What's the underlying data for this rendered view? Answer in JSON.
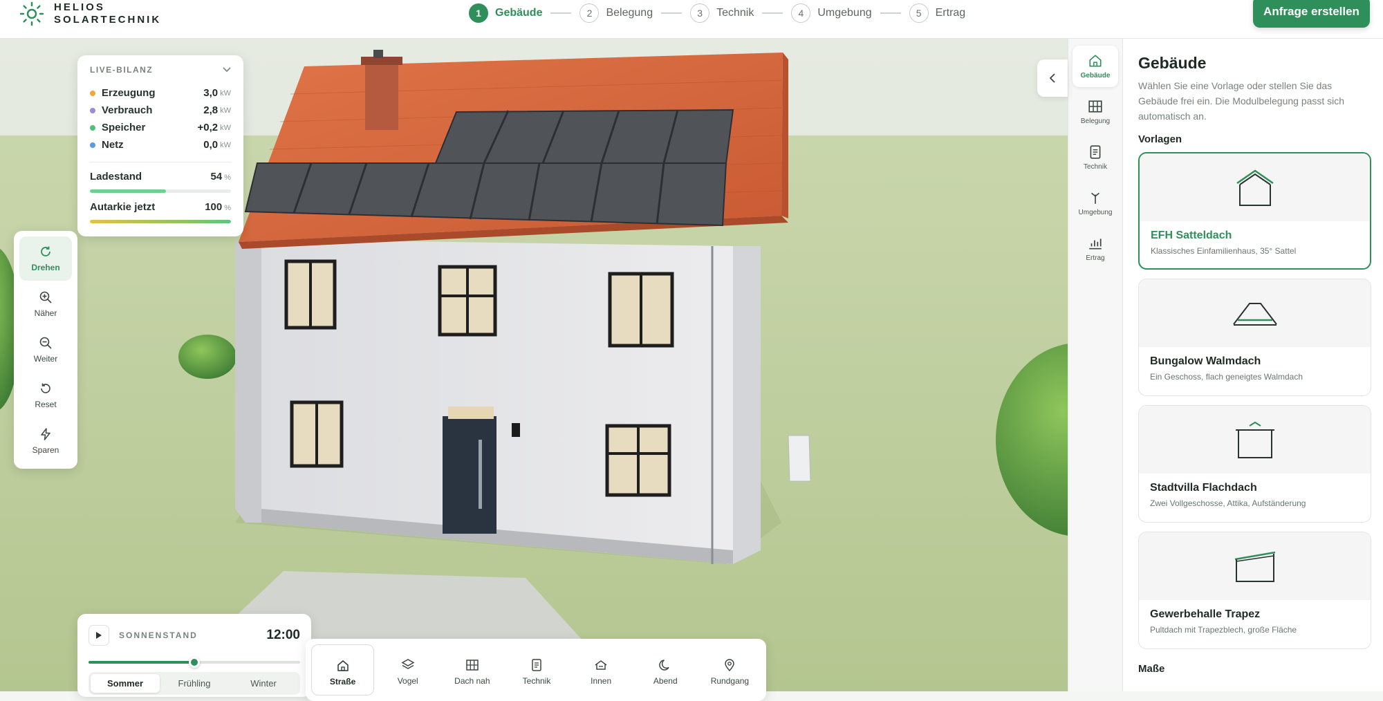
{
  "brand": {
    "line1": "HELIOS",
    "line2": "SOLARTECHNIK"
  },
  "steps": [
    {
      "num": "1",
      "label": "Gebäude",
      "active": true
    },
    {
      "num": "2",
      "label": "Belegung"
    },
    {
      "num": "3",
      "label": "Technik"
    },
    {
      "num": "4",
      "label": "Umgebung"
    },
    {
      "num": "5",
      "label": "Ertrag"
    }
  ],
  "cta_label": "Anfrage erstellen",
  "live": {
    "title": "LIVE-BILANZ",
    "rows": [
      {
        "label": "Erzeugung",
        "value": "3,0",
        "unit": "kW",
        "color": "#f0a63a"
      },
      {
        "label": "Verbrauch",
        "value": "2,8",
        "unit": "kW",
        "color": "#9b8bd6"
      },
      {
        "label": "Speicher",
        "value": "+0,2",
        "unit": "kW",
        "color": "#4fc07a"
      },
      {
        "label": "Netz",
        "value": "0,0",
        "unit": "kW",
        "color": "#5a9be0"
      }
    ],
    "ladestand": {
      "label": "Ladestand",
      "value": "54",
      "unit": "%",
      "fraction": 0.54
    },
    "autarkie": {
      "label": "Autarkie jetzt",
      "value": "100",
      "unit": "%",
      "fraction": 1.0
    }
  },
  "tools": [
    {
      "label": "Drehen",
      "icon": "rotate-icon",
      "active": true
    },
    {
      "label": "Näher",
      "icon": "zoom-in-icon"
    },
    {
      "label": "Weiter",
      "icon": "zoom-out-icon"
    },
    {
      "label": "Reset",
      "icon": "reset-icon"
    },
    {
      "label": "Sparen",
      "icon": "bolt-icon"
    }
  ],
  "sun": {
    "title": "SONNENSTAND",
    "time": "12:00",
    "position": 0.5,
    "seasons": [
      "Sommer",
      "Frühling",
      "Winter"
    ],
    "active_season": "Sommer"
  },
  "views": [
    {
      "label": "Straße",
      "icon": "house-icon",
      "active": true
    },
    {
      "label": "Vogel",
      "icon": "layers-icon"
    },
    {
      "label": "Dach nah",
      "icon": "grid-icon"
    },
    {
      "label": "Technik",
      "icon": "document-icon"
    },
    {
      "label": "Innen",
      "icon": "house-inner-icon"
    },
    {
      "label": "Abend",
      "icon": "moon-icon"
    },
    {
      "label": "Rundgang",
      "icon": "pin-icon"
    }
  ],
  "rail": [
    {
      "label": "Gebäude",
      "icon": "house-icon",
      "active": true
    },
    {
      "label": "Belegung",
      "icon": "grid-icon"
    },
    {
      "label": "Technik",
      "icon": "document-icon"
    },
    {
      "label": "Umgebung",
      "icon": "tree-icon"
    },
    {
      "label": "Ertrag",
      "icon": "chart-icon"
    }
  ],
  "panel": {
    "title": "Gebäude",
    "description": "Wählen Sie eine Vorlage oder stellen Sie das Gebäude frei ein. Die Modulbelegung passt sich automatisch an.",
    "templates_heading": "Vorlagen",
    "templates": [
      {
        "title": "EFH Satteldach",
        "subtitle": "Klassisches Einfamilienhaus, 35° Sattel",
        "active": true
      },
      {
        "title": "Bungalow Walmdach",
        "subtitle": "Ein Geschoss, flach geneigtes Walmdach"
      },
      {
        "title": "Stadtvilla Flachdach",
        "subtitle": "Zwei Vollgeschosse, Attika, Aufständerung"
      },
      {
        "title": "Gewerbehalle Trapez",
        "subtitle": "Pultdach mit Trapezblech, große Fläche"
      }
    ],
    "dimensions_heading": "Maße"
  },
  "colors": {
    "accent": "#2f8f5b",
    "roof": "#d9643d",
    "grass": "#b7c98f"
  }
}
